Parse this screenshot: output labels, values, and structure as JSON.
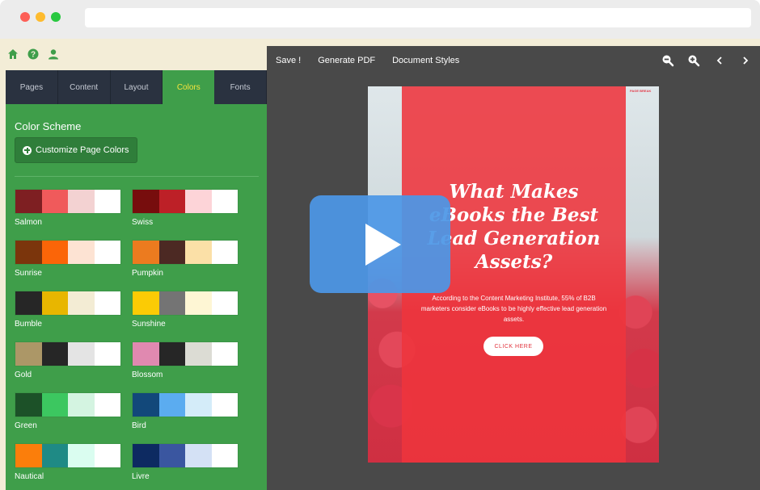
{
  "tabs": [
    "Pages",
    "Content",
    "Layout",
    "Colors",
    "Fonts"
  ],
  "active_tab": "Colors",
  "panel": {
    "title": "Color Scheme",
    "customize_label": "Customize Page Colors"
  },
  "schemes": [
    {
      "name": "Salmon",
      "colors": [
        "#7e1f22",
        "#f05a5b",
        "#f3d2d2",
        "#ffffff"
      ]
    },
    {
      "name": "Swiss",
      "colors": [
        "#770d0d",
        "#bd2027",
        "#fdd4d8",
        "#ffffff"
      ]
    },
    {
      "name": "Sunrise",
      "colors": [
        "#7b350c",
        "#fb6508",
        "#fde3d3",
        "#ffffff"
      ]
    },
    {
      "name": "Pumpkin",
      "colors": [
        "#ec7b1f",
        "#4c2923",
        "#fbe0a7",
        "#ffffff"
      ]
    },
    {
      "name": "Bumble",
      "colors": [
        "#262626",
        "#e8b600",
        "#f3ecd4",
        "#ffffff"
      ]
    },
    {
      "name": "Sunshine",
      "colors": [
        "#fbcb05",
        "#747474",
        "#fef6d4",
        "#ffffff"
      ]
    },
    {
      "name": "Gold",
      "colors": [
        "#ac9767",
        "#262626",
        "#e4e4e4",
        "#ffffff"
      ]
    },
    {
      "name": "Blossom",
      "colors": [
        "#e089b0",
        "#262626",
        "#dcdcd4",
        "#ffffff"
      ]
    },
    {
      "name": "Green",
      "colors": [
        "#1c5128",
        "#3cc760",
        "#d4f4e1",
        "#ffffff"
      ]
    },
    {
      "name": "Bird",
      "colors": [
        "#12487a",
        "#5bacf0",
        "#d4ecf9",
        "#ffffff"
      ]
    },
    {
      "name": "Nautical",
      "colors": [
        "#fb7e0b",
        "#1f8a85",
        "#dafdf0",
        "#ffffff"
      ]
    },
    {
      "name": "Livre",
      "colors": [
        "#0d2a61",
        "#3a56a0",
        "#d4e1f5",
        "#ffffff"
      ]
    }
  ],
  "toolbar": {
    "save": "Save !",
    "generate_pdf": "Generate PDF",
    "document_styles": "Document Styles"
  },
  "preview": {
    "brand": "PAGE BREAK",
    "headline": "What Makes eBooks the Best Lead Generation Assets?",
    "body": "According to the Content Marketing Institute, 55% of B2B marketers consider eBooks to be highly effective lead generation assets.",
    "cta": "CLICK HERE"
  },
  "colors": {
    "panel_green": "#3f9e4a",
    "tab_dark": "#2a3240",
    "active_tab_text": "#f5e33e",
    "editor_bg": "#494949",
    "overlay_red": "#ee343c",
    "play_blue": "#4c97e6"
  }
}
